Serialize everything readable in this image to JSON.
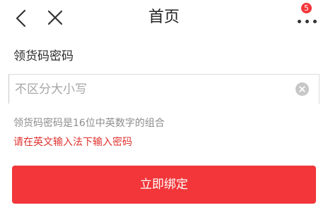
{
  "header": {
    "title": "首页",
    "back_icon": "chevron-left-icon",
    "close_icon": "close-icon",
    "more_icon": "more-dots-icon",
    "badge_count": "5"
  },
  "form": {
    "label": "领货码密码",
    "input": {
      "value": "",
      "placeholder": "不区分大小写"
    },
    "clear_icon": "clear-circle-icon",
    "hint": "领货码密码是16位中英数字的组合",
    "warning": "请在英文输入法下输入密码",
    "submit_label": "立即绑定"
  },
  "colors": {
    "accent": "#f2363a",
    "warning_text": "#e0312e",
    "hint_text": "#8d8d8d",
    "placeholder_text": "#a6a6a6"
  }
}
